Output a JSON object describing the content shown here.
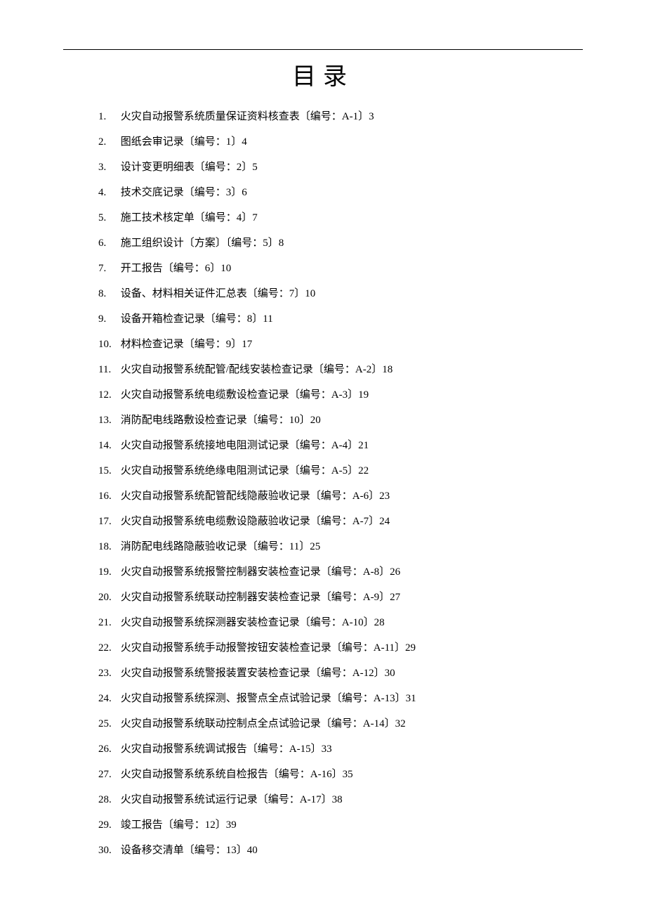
{
  "title": "目录",
  "entries": [
    {
      "n": "1.",
      "text": "火灾自动报警系统质量保证资料核查表〔编号：A-1〕3"
    },
    {
      "n": "2.",
      "text": "图纸会审记录〔编号：1〕4"
    },
    {
      "n": "3.",
      "text": "设计变更明细表〔编号：2〕5"
    },
    {
      "n": "4.",
      "text": "技术交底记录〔编号：3〕6"
    },
    {
      "n": "5.",
      "text": "施工技术核定单〔编号：4〕7"
    },
    {
      "n": "6.",
      "text": "施工组织设计〔方案〕〔编号：5〕8"
    },
    {
      "n": "7.",
      "text": "开工报告〔编号：6〕10"
    },
    {
      "n": "8.",
      "text": "设备、材料相关证件汇总表〔编号：7〕10"
    },
    {
      "n": "9.",
      "text": "设备开箱检查记录〔编号：8〕11"
    },
    {
      "n": "10.",
      "text": "材料检查记录〔编号：9〕17"
    },
    {
      "n": "11.",
      "text": "火灾自动报警系统配管/配线安装检查记录〔编号：A-2〕18"
    },
    {
      "n": "12.",
      "text": "火灾自动报警系统电缆敷设检查记录〔编号：A-3〕19"
    },
    {
      "n": "13.",
      "text": "消防配电线路敷设检查记录〔编号：10〕20"
    },
    {
      "n": "14.",
      "text": "火灾自动报警系统接地电阻测试记录〔编号：A-4〕21"
    },
    {
      "n": "15.",
      "text": "火灾自动报警系统绝缘电阻测试记录〔编号：A-5〕22"
    },
    {
      "n": "16.",
      "text": "火灾自动报警系统配管配线隐蔽验收记录〔编号：A-6〕23"
    },
    {
      "n": "17.",
      "text": "火灾自动报警系统电缆敷设隐蔽验收记录〔编号：A-7〕24"
    },
    {
      "n": "18.",
      "text": "消防配电线路隐蔽验收记录〔编号：11〕25"
    },
    {
      "n": "19.",
      "text": "火灾自动报警系统报警控制器安装检查记录〔编号：A-8〕26"
    },
    {
      "n": "20.",
      "text": "火灾自动报警系统联动控制器安装检查记录〔编号：A-9〕27"
    },
    {
      "n": "21.",
      "text": "火灾自动报警系统探测器安装检查记录〔编号：A-10〕28"
    },
    {
      "n": "22.",
      "text": "火灾自动报警系统手动报警按钮安装检查记录〔编号：A-11〕29"
    },
    {
      "n": "23.",
      "text": "火灾自动报警系统警报装置安装检查记录〔编号：A-12〕30"
    },
    {
      "n": "24.",
      "text": "火灾自动报警系统探测、报警点全点试验记录〔编号：A-13〕31"
    },
    {
      "n": "25.",
      "text": "火灾自动报警系统联动控制点全点试验记录〔编号：A-14〕32"
    },
    {
      "n": "26.",
      "text": "火灾自动报警系统调试报告〔编号：A-15〕33"
    },
    {
      "n": "27.",
      "text": "火灾自动报警系统系统自检报告〔编号：A-16〕35"
    },
    {
      "n": "28.",
      "text": "火灾自动报警系统试运行记录〔编号：A-17〕38"
    },
    {
      "n": "29.",
      "text": "竣工报告〔编号：12〕39"
    },
    {
      "n": "30.",
      "text": "设备移交清单〔编号：13〕40"
    }
  ]
}
